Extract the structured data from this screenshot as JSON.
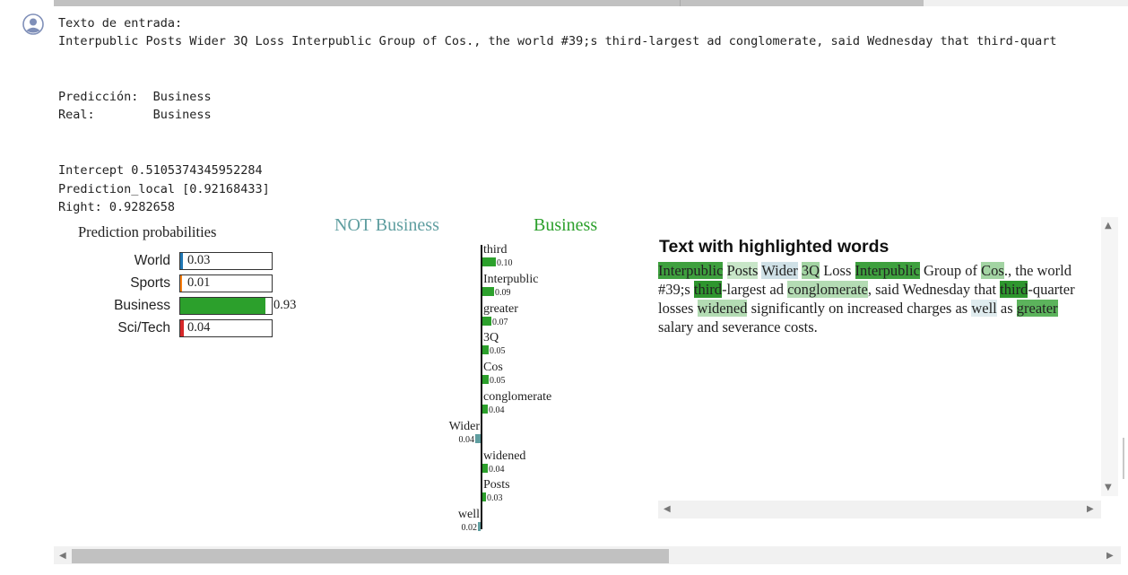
{
  "output": {
    "input_label": "Texto de entrada:",
    "input_text": "Interpublic Posts Wider 3Q Loss Interpublic Group of Cos., the world #39;s third-largest ad conglomerate, said Wednesday that third-quart",
    "pred_line": "Predicción:  Business",
    "real_line": "Real:        Business",
    "intercept_line": "Intercept 0.5105374345952284",
    "prediction_local_line": "Prediction_local [0.92168433]",
    "right_line": "Right: 0.9282658"
  },
  "prediction_probabilities": {
    "title": "Prediction probabilities",
    "rows": [
      {
        "label": "World",
        "value": "0.03",
        "fraction": 0.03,
        "color": "#1f77b4"
      },
      {
        "label": "Sports",
        "value": "0.01",
        "fraction": 0.01,
        "color": "#ff7f0e"
      },
      {
        "label": "Business",
        "value": "0.93",
        "fraction": 0.93,
        "color": "#2ca02c"
      },
      {
        "label": "Sci/Tech",
        "value": "0.04",
        "fraction": 0.04,
        "color": "#d62728"
      }
    ]
  },
  "chart_data": {
    "type": "bar",
    "left_header": "NOT Business",
    "right_header": "Business",
    "left_color": "#5f9ea0",
    "right_color": "#2ca02c",
    "features": [
      {
        "word": "third",
        "value": "0.10",
        "weight": 0.1
      },
      {
        "word": "Interpublic",
        "value": "0.09",
        "weight": 0.09
      },
      {
        "word": "greater",
        "value": "0.07",
        "weight": 0.07
      },
      {
        "word": "3Q",
        "value": "0.05",
        "weight": 0.05
      },
      {
        "word": "Cos",
        "value": "0.05",
        "weight": 0.05
      },
      {
        "word": "conglomerate",
        "value": "0.04",
        "weight": 0.04
      },
      {
        "word": "Wider",
        "value": "0.04",
        "weight": -0.04
      },
      {
        "word": "widened",
        "value": "0.04",
        "weight": 0.04
      },
      {
        "word": "Posts",
        "value": "0.03",
        "weight": 0.03
      },
      {
        "word": "well",
        "value": "0.02",
        "weight": -0.02
      }
    ]
  },
  "highlight": {
    "title": "Text with highlighted words",
    "segments": [
      {
        "t": "Interpublic",
        "bg": "#3ea03e"
      },
      {
        "t": " "
      },
      {
        "t": "Posts",
        "bg": "#c8e6c8"
      },
      {
        "t": " "
      },
      {
        "t": "Wider",
        "bg": "#cfe0e6"
      },
      {
        "t": " "
      },
      {
        "t": "3Q",
        "bg": "#a3d4a3"
      },
      {
        "t": " Loss "
      },
      {
        "t": "Interpublic",
        "bg": "#3ea03e"
      },
      {
        "t": " Group of "
      },
      {
        "t": "Cos",
        "bg": "#a3d4a3"
      },
      {
        "t": "., the world #39;s "
      },
      {
        "t": "third",
        "bg": "#2e962e"
      },
      {
        "t": "-largest ad "
      },
      {
        "t": "conglomerate",
        "bg": "#b4dcb4"
      },
      {
        "t": ", said Wednesday that "
      },
      {
        "t": "third",
        "bg": "#2e962e"
      },
      {
        "t": "-quarter losses "
      },
      {
        "t": "widened",
        "bg": "#b4dcb4"
      },
      {
        "t": " significantly on increased charges as "
      },
      {
        "t": "well",
        "bg": "#e0ecef"
      },
      {
        "t": " as "
      },
      {
        "t": "greater",
        "bg": "#5cb35c"
      },
      {
        "t": " salary and severance costs."
      }
    ]
  }
}
